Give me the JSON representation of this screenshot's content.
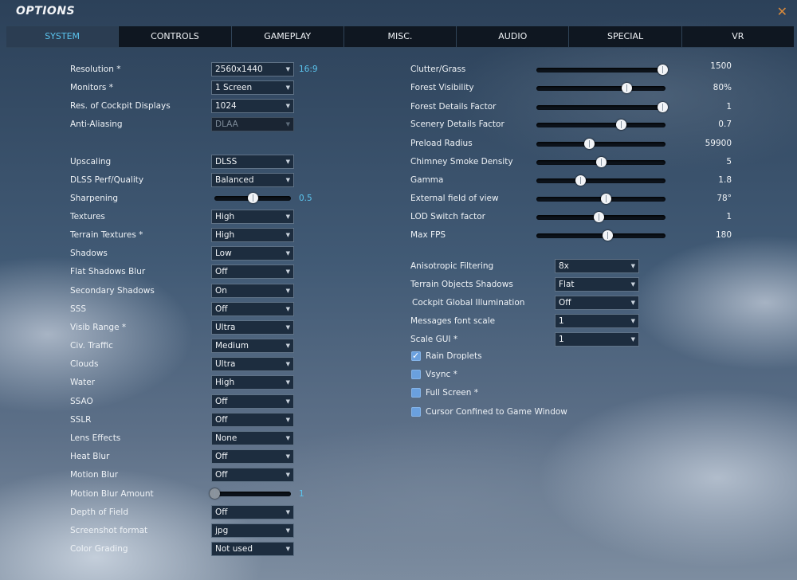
{
  "window": {
    "title": "OPTIONS",
    "close_glyph": "✕"
  },
  "tabs": [
    {
      "label": "SYSTEM"
    },
    {
      "label": "CONTROLS"
    },
    {
      "label": "GAMEPLAY"
    },
    {
      "label": "MISC."
    },
    {
      "label": "AUDIO"
    },
    {
      "label": "SPECIAL"
    },
    {
      "label": "VR"
    }
  ],
  "active_tab": "SYSTEM",
  "left": [
    {
      "label": "Resolution *",
      "value": "2560x1440",
      "hint": "16:9"
    },
    {
      "label": "Monitors *",
      "value": "1 Screen"
    },
    {
      "label": "Res. of Cockpit Displays",
      "value": "1024"
    },
    {
      "label": "Anti-Aliasing",
      "value": "DLAA",
      "disabled": true
    },
    {
      "label": "Upscaling",
      "value": "DLSS"
    },
    {
      "label": "DLSS Perf/Quality",
      "value": "Balanced"
    },
    {
      "label": "Sharpening",
      "slider": 0.5,
      "hint": "0.5"
    },
    {
      "label": "Textures",
      "value": "High"
    },
    {
      "label": "Terrain Textures *",
      "value": "High"
    },
    {
      "label": "Shadows",
      "value": "Low"
    },
    {
      "label": "Flat Shadows Blur",
      "value": "Off"
    },
    {
      "label": "Secondary Shadows",
      "value": "On"
    },
    {
      "label": "SSS",
      "value": "Off"
    },
    {
      "label": "Visib Range *",
      "value": "Ultra"
    },
    {
      "label": "Civ. Traffic",
      "value": "Medium"
    },
    {
      "label": "Clouds",
      "value": "Ultra"
    },
    {
      "label": "Water",
      "value": "High"
    },
    {
      "label": "SSAO",
      "value": "Off"
    },
    {
      "label": "SSLR",
      "value": "Off"
    },
    {
      "label": "Lens Effects",
      "value": "None"
    },
    {
      "label": "Heat Blur",
      "value": "Off"
    },
    {
      "label": "Motion Blur",
      "value": "Off"
    },
    {
      "label": "Motion Blur Amount",
      "slider": 0.0,
      "hint": "1",
      "disabled_slider": true
    },
    {
      "label": "Depth of Field",
      "value": "Off"
    },
    {
      "label": "Screenshot format",
      "value": "jpg"
    },
    {
      "label": "Color Grading",
      "value": "Not used"
    }
  ],
  "right_sliders": [
    {
      "label": "Clutter/Grass",
      "value": "1500",
      "level": 1.0
    },
    {
      "label": "Forest Visibility",
      "value": "80%",
      "level": 0.71
    },
    {
      "label": "Forest Details Factor",
      "value": "1",
      "level": 1.0
    },
    {
      "label": "Scenery Details Factor",
      "value": "0.7",
      "level": 0.66
    },
    {
      "label": "Preload Radius",
      "value": "59900",
      "level": 0.4
    },
    {
      "label": "Chimney Smoke Density",
      "value": "5",
      "level": 0.5
    },
    {
      "label": "Gamma",
      "value": "1.8",
      "level": 0.33
    },
    {
      "label": "External field of view",
      "value": "78°",
      "level": 0.54
    },
    {
      "label": "LOD Switch factor",
      "value": "1",
      "level": 0.48
    },
    {
      "label": "Max FPS",
      "value": "180",
      "level": 0.55
    }
  ],
  "right_selects": [
    {
      "label": "Anisotropic Filtering",
      "value": "8x"
    },
    {
      "label": "Terrain Objects Shadows",
      "value": "Flat"
    },
    {
      "label": "Cockpit Global Illumination",
      "value": "Off"
    },
    {
      "label": "Messages font scale",
      "value": "1"
    },
    {
      "label": "Scale GUI *",
      "value": "1"
    }
  ],
  "checkboxes": [
    {
      "label": "Rain Droplets",
      "checked": true
    },
    {
      "label": "Vsync *",
      "checked": false
    },
    {
      "label": "Full Screen *",
      "checked": false
    },
    {
      "label": "Cursor Confined to Game Window",
      "checked": false
    }
  ],
  "colors": {
    "accent": "#5bc4ee",
    "close": "#d98a3c",
    "tab_bar": "#0f1721",
    "tab_active": "#2b3d52",
    "checkbox": "#6aa0de"
  },
  "icons": {
    "dropdown": "chevron-down-icon",
    "close": "close-icon",
    "checkbox": "checkmark-icon"
  }
}
